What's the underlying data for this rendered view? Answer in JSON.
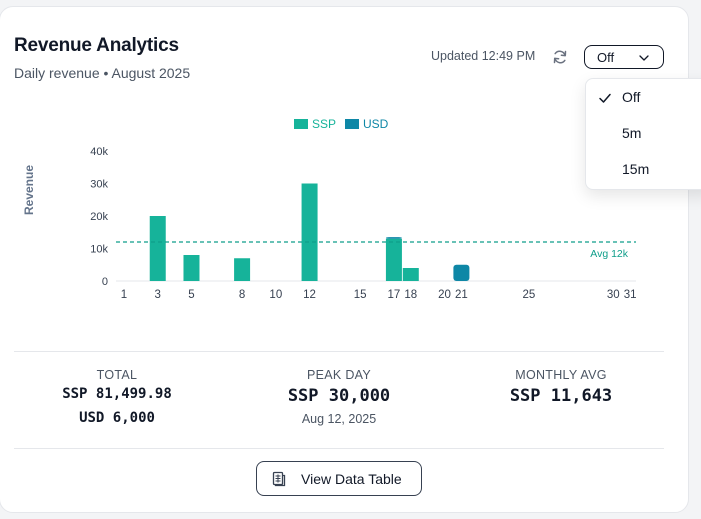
{
  "header": {
    "title": "Revenue Analytics",
    "subtitle": "Daily revenue • August 2025",
    "updated": "Updated 12:49 PM",
    "refresh_icon": "refresh-icon",
    "interval_value": "Off"
  },
  "interval_menu": {
    "items": [
      {
        "label": "Off",
        "selected": true
      },
      {
        "label": "5m",
        "selected": false
      },
      {
        "label": "15m",
        "selected": false
      }
    ]
  },
  "colors": {
    "ssp": "#16b39a",
    "usd": "#0e87a6",
    "avg": "#0f9e8a"
  },
  "chart_data": {
    "type": "bar",
    "stacked": true,
    "ylabel": "Revenue",
    "ylim": [
      0,
      40000
    ],
    "yticks": [
      "0",
      "10k",
      "20k",
      "30k",
      "40k"
    ],
    "x_tick_labels": [
      "1",
      "3",
      "5",
      "8",
      "10",
      "12",
      "15",
      "17",
      "18",
      "20",
      "21",
      "25",
      "30",
      "31"
    ],
    "days": [
      1,
      3,
      5,
      8,
      10,
      12,
      15,
      17,
      18,
      20,
      21,
      25,
      30,
      31
    ],
    "series": [
      {
        "name": "SSP",
        "values": [
          0,
          20000,
          8000,
          7000,
          0,
          30000,
          0,
          13000,
          4000,
          0,
          0,
          0,
          0,
          0
        ]
      },
      {
        "name": "USD",
        "values": [
          0,
          0,
          0,
          0,
          0,
          0,
          0,
          500,
          0,
          0,
          5000,
          0,
          0,
          0
        ]
      }
    ],
    "average": {
      "value": 12000,
      "label": "Avg 12k"
    },
    "legend_position": "top"
  },
  "stats": {
    "total": {
      "label": "TOTAL",
      "ssp": "SSP 81,499.98",
      "usd": "USD 6,000"
    },
    "peak": {
      "label": "PEAK DAY",
      "value": "SSP 30,000",
      "date": "Aug 12, 2025"
    },
    "monthly_avg": {
      "label": "MONTHLY AVG",
      "value": "SSP 11,643"
    }
  },
  "view_table_button": {
    "label": "View Data Table",
    "icon": "table-icon"
  }
}
